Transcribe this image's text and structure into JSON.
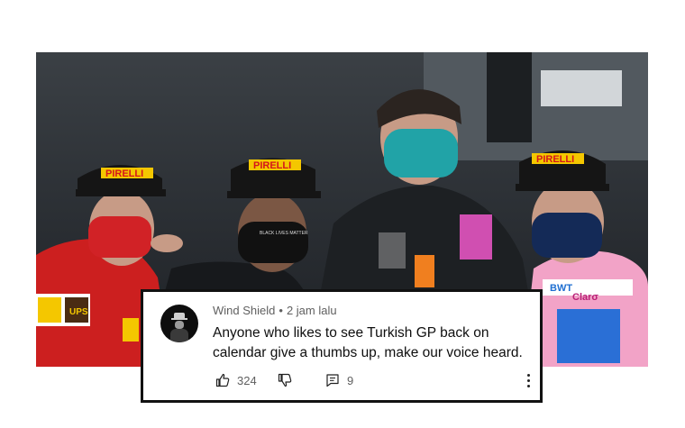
{
  "photo": {
    "description_icon": "podium-photo",
    "cap_brand": "PIRELLI",
    "mask_text": "BLACK LIVES MATTER",
    "sponsor_1": "UPS",
    "sponsor_2": "BWT",
    "sponsor_3": "Clarσ"
  },
  "comment": {
    "author": "Wind Shield",
    "separator": "•",
    "time": "2 jam lalu",
    "text": "Anyone who likes to see Turkish GP back on calendar give a thumbs up, make our voice heard.",
    "likes": "324",
    "replies": "9"
  },
  "icons": {
    "like": "thumbs-up-icon",
    "dislike": "thumbs-down-icon",
    "reply": "reply-comment-icon",
    "menu": "more-vertical-icon"
  },
  "colors": {
    "ferrari_red": "#d5161b",
    "mercedes_black": "#15171a",
    "teal_mask": "#21a3a7",
    "pink_suit": "#f2a3c7"
  }
}
